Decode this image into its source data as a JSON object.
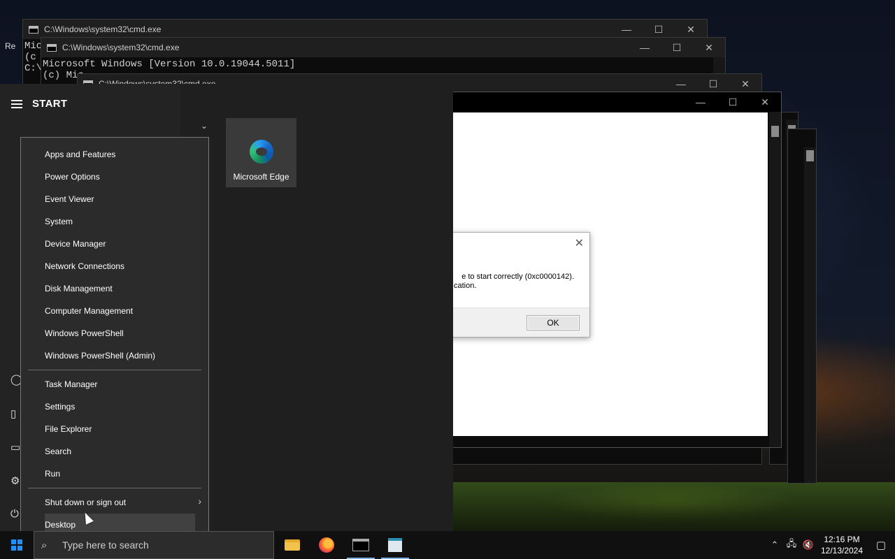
{
  "desktop": {
    "partial_label": "Re"
  },
  "cmd_windows": [
    {
      "title": "C:\\Windows\\system32\\cmd.exe",
      "lines": [
        "Mic",
        "(c",
        "",
        "C:\\"
      ]
    },
    {
      "title": "C:\\Windows\\system32\\cmd.exe",
      "lines": [
        "Microsoft Windows [Version 10.0.19044.5011]",
        "(c) Mic"
      ]
    },
    {
      "title": "C:\\Windows\\system32\\cmd.exe",
      "lines": []
    }
  ],
  "window_controls": {
    "minimize": "—",
    "maximize": "☐",
    "close": "✕"
  },
  "error_dialog": {
    "message_line1": "e to start correctly (0xc0000142).",
    "message_line2": "cation.",
    "ok_label": "OK",
    "close_glyph": "✕"
  },
  "start_menu": {
    "header": "START",
    "tile": {
      "label": "Microsoft Edge",
      "icon": "edge-icon"
    },
    "chevron": "⌄"
  },
  "winx_menu": {
    "group1": [
      "Apps and Features",
      "Power Options",
      "Event Viewer",
      "System",
      "Device Manager",
      "Network Connections",
      "Disk Management",
      "Computer Management",
      "Windows PowerShell",
      "Windows PowerShell (Admin)"
    ],
    "group2": [
      "Task Manager",
      "Settings",
      "File Explorer",
      "Search",
      "Run"
    ],
    "group3": [
      "Shut down or sign out",
      "Desktop"
    ],
    "hovered": "Desktop",
    "submenu_arrow": "›"
  },
  "taskbar": {
    "search_placeholder": "Type here to search",
    "apps": [
      "file-explorer-icon",
      "firefox-icon",
      "cmd-icon",
      "notepad-icon"
    ],
    "clock_time": "12:16 PM",
    "clock_date": "12/13/2024",
    "tray_icons": [
      "chevron-up-icon",
      "network-icon",
      "volume-muted-icon"
    ]
  },
  "colors": {
    "accent": "#1e90ff",
    "menu_bg": "#2b2b2b",
    "start_bg": "#1f1f1f"
  }
}
